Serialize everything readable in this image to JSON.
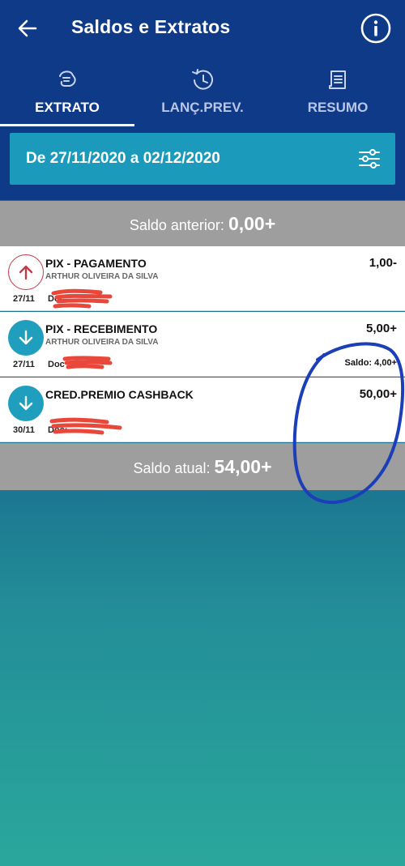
{
  "header": {
    "title": "Saldos e Extratos"
  },
  "tabs": [
    {
      "label": "EXTRATO",
      "icon": "hand-money-icon",
      "active": true
    },
    {
      "label": "LANÇ.PREV.",
      "icon": "clock-history-icon",
      "active": false
    },
    {
      "label": "RESUMO",
      "icon": "document-list-icon",
      "active": false
    }
  ],
  "filter": {
    "date_range": "De 27/11/2020 a 02/12/2020",
    "icon": "sliders-icon"
  },
  "saldo_anterior": {
    "label": "Saldo anterior:",
    "value": "0,00+"
  },
  "transactions": [
    {
      "direction": "out",
      "icon": "arrow-up-icon",
      "date": "27/11",
      "doc": "Doc",
      "name": "PIX - PAGAMENTO",
      "subtitle": "ARTHUR OLIVEIRA DA SILVA",
      "amount": "1,00-"
    },
    {
      "direction": "in",
      "icon": "arrow-down-icon",
      "date": "27/11",
      "doc": "Doc",
      "name": "PIX - RECEBIMENTO",
      "subtitle": "ARTHUR OLIVEIRA DA SILVA",
      "amount": "5,00+",
      "saldo": "Saldo:  4,00+"
    },
    {
      "direction": "in",
      "icon": "arrow-down-icon",
      "date": "30/11",
      "doc": "Doc:",
      "name": "CRED.PREMIO CASHBACK",
      "amount": "50,00+"
    }
  ],
  "saldo_atual": {
    "label": "Saldo atual:",
    "value": "54,00+"
  },
  "colors": {
    "header_bg": "#0f3a88",
    "date_bar": "#1c9abb",
    "band_gray": "#9e9e9e",
    "out_red": "#c23b4a",
    "in_teal": "#1f9fbd",
    "redaction": "#e8473a",
    "annotation_blue": "#1a3fb8"
  }
}
